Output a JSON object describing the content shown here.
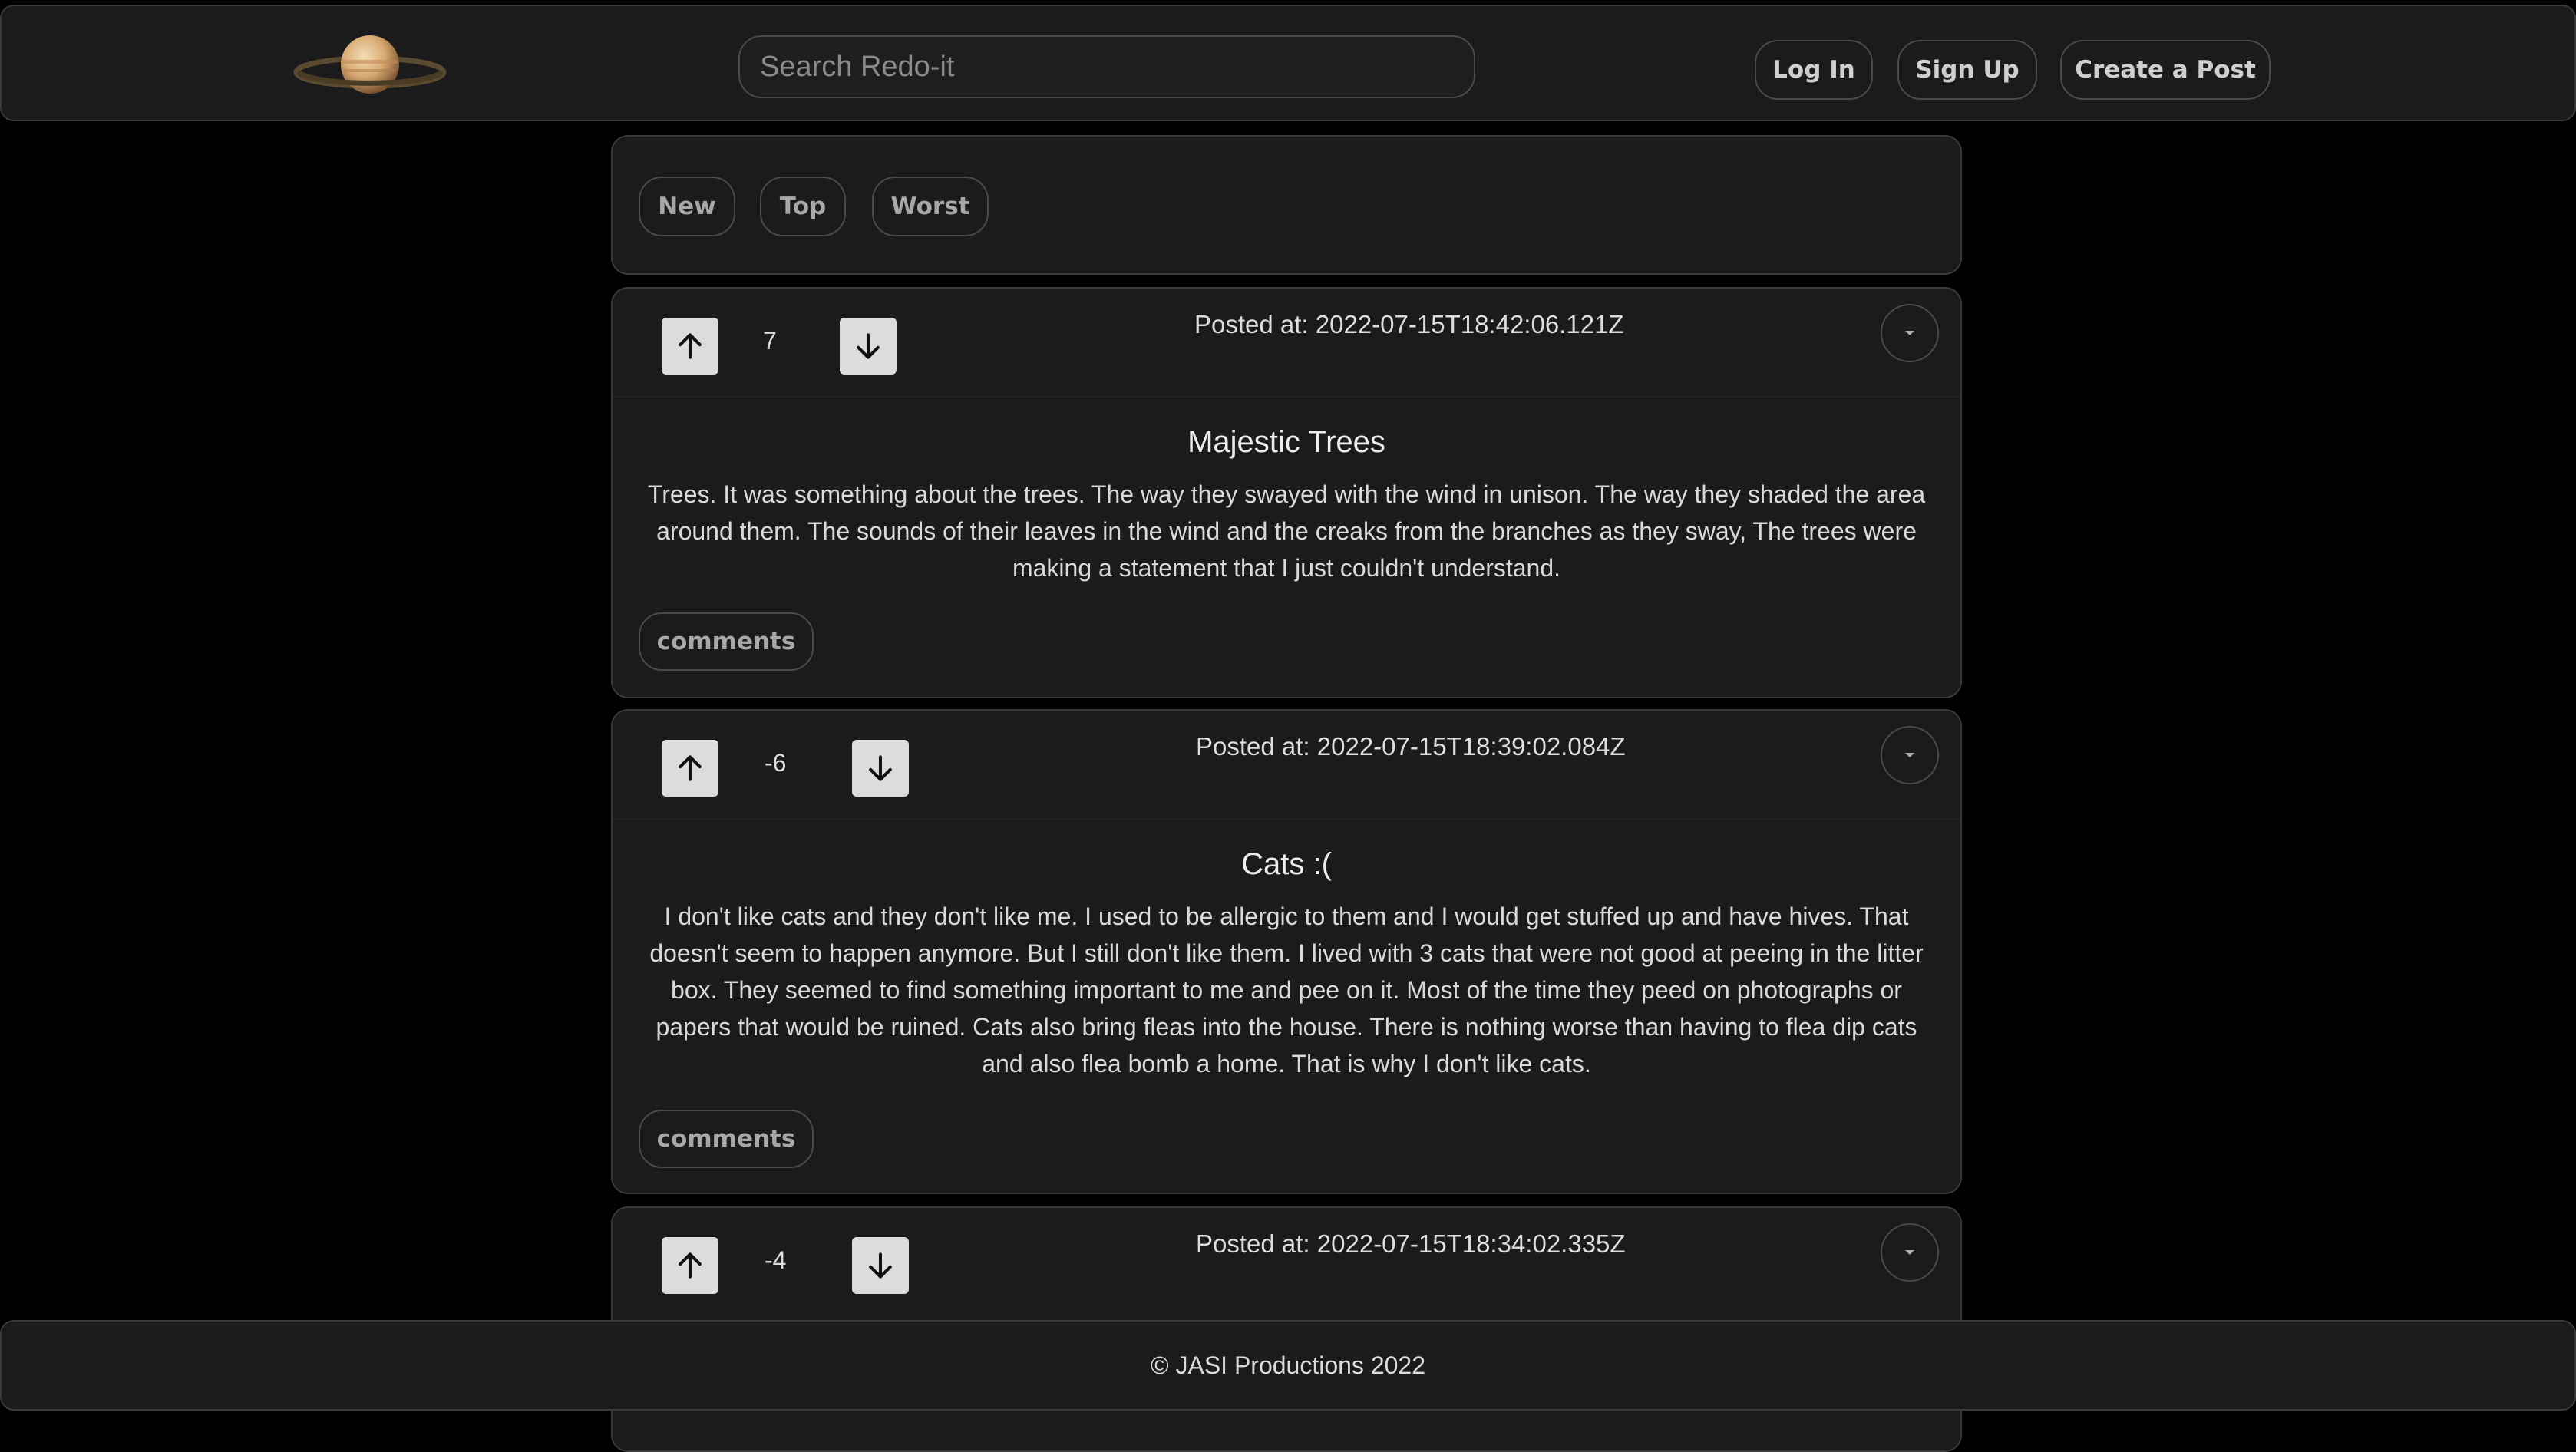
{
  "header": {
    "logo_icon": "saturn-planet-icon",
    "search_placeholder": "Search Redo-it",
    "login_label": "Log In",
    "signup_label": "Sign Up",
    "create_post_label": "Create a Post"
  },
  "sort": {
    "new_label": "New",
    "top_label": "Top",
    "worst_label": "Worst"
  },
  "posts": [
    {
      "score": "7",
      "posted_at": "Posted at: 2022-07-15T18:42:06.121Z",
      "title": "Majestic Trees",
      "body": "Trees. It was something about the trees. The way they swayed with the wind in unison. The way they shaded the area around them. The sounds of their leaves in the wind and the creaks from the branches as they sway, The trees were making a statement that I just couldn't understand.",
      "comments_label": "comments"
    },
    {
      "score": "-6",
      "posted_at": "Posted at: 2022-07-15T18:39:02.084Z",
      "title": "Cats :(",
      "body": "I don't like cats and they don't like me. I used to be allergic to them and I would get stuffed up and have hives. That doesn't seem to happen anymore. But I still don't like them. I lived with 3 cats that were not good at peeing in the litter box. They seemed to find something important to me and pee on it. Most of the time they peed on photographs or papers that would be ruined. Cats also bring fleas into the house. There is nothing worse than having to flea dip cats and also flea bomb a home. That is why I don't like cats.",
      "comments_label": "comments"
    },
    {
      "score": "-4",
      "posted_at": "Posted at: 2022-07-15T18:34:02.335Z"
    }
  ],
  "footer": {
    "copyright": "© JASI Productions 2022"
  },
  "colors": {
    "background": "#000000",
    "panel": "#1b1b1b",
    "border": "#3a3a3a",
    "vote_button": "#dcdcdc"
  }
}
